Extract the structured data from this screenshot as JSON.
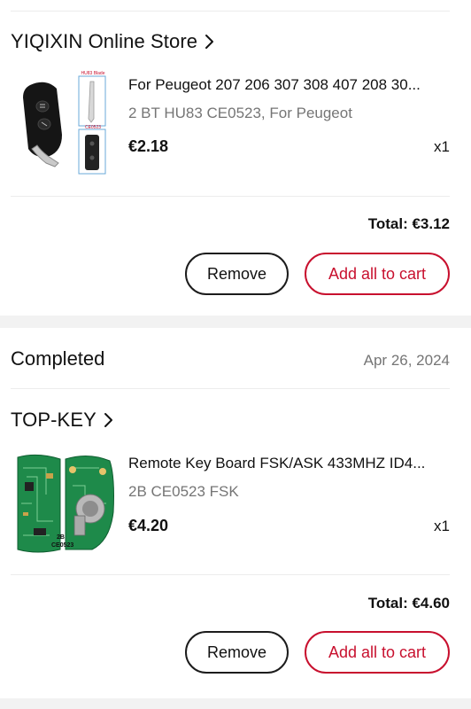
{
  "colors": {
    "accent": "#c8102e",
    "text": "#111111",
    "muted": "#757575",
    "separator": "#f2f2f2",
    "pcb_green": "#1e8a4a"
  },
  "order1": {
    "store_name": "YIQIXIN Online Store",
    "store_icon": "chevron-right-icon",
    "item": {
      "title": "For Peugeot 207 206 307 308 407 208 30...",
      "variant": "2 BT HU83 CE0523, For Peugeot",
      "price": "€2.18",
      "quantity": "x1",
      "image_labels": [
        "HU83 Blade",
        "CE0523"
      ]
    },
    "total": "Total: €3.12",
    "remove_label": "Remove",
    "add_all_label": "Add all to cart"
  },
  "order2": {
    "status": "Completed",
    "date": "Apr 26, 2024",
    "store_name": "TOP-KEY",
    "store_icon": "chevron-right-icon",
    "item": {
      "title": "Remote Key Board FSK/ASK 433MHZ ID4...",
      "variant": "2B CE0523 FSK",
      "price": "€4.20",
      "quantity": "x1",
      "image_labels": [
        "2B",
        "CE0523"
      ]
    },
    "total": "Total: €4.60",
    "remove_label": "Remove",
    "add_all_label": "Add all to cart"
  }
}
